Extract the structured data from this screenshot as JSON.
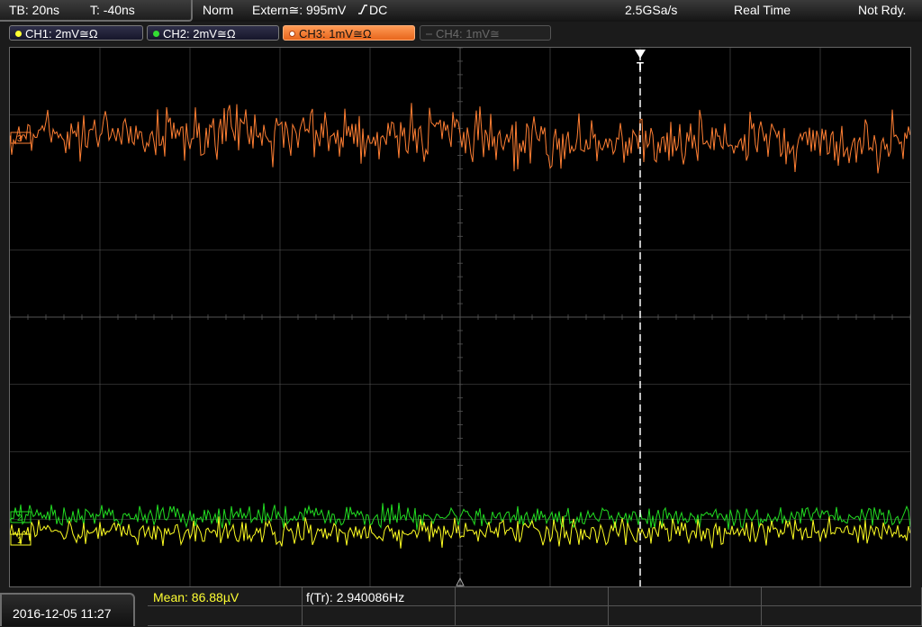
{
  "status": {
    "timebase": "TB: 20ns",
    "trigger_time": "T: -40ns",
    "trigger_mode": "Norm",
    "trigger_source": "Extern≅: 995mV",
    "trigger_coupling": "DC",
    "sample_rate": "2.5GSa/s",
    "acq_mode": "Real Time",
    "state": "Not Rdy."
  },
  "channels": [
    {
      "label": "CH1: 2mV≅Ω",
      "color": "#ffff33",
      "state": "on"
    },
    {
      "label": "CH2: 2mV≅Ω",
      "color": "#33dd33",
      "state": "on"
    },
    {
      "label": "CH3: 1mV≅Ω",
      "color": "#ff8c40",
      "state": "selected"
    },
    {
      "label": "CH4: 1mV≅",
      "color": "#888888",
      "state": "off"
    }
  ],
  "waveform": {
    "colors": {
      "ch1": "#ffff22",
      "ch2": "#22dd22",
      "ch3": "#ff7f33",
      "grid": "#555555",
      "trigger": "#ffffff"
    },
    "markers": {
      "ch1": "1",
      "ch2": "2",
      "ch3": "3",
      "trigger": "T"
    }
  },
  "footer": {
    "datetime": "2016-12-05 11:27",
    "measure_mean": "Mean: 86.88µV",
    "measure_freq": "f(Tr): 2.940086Hz"
  }
}
